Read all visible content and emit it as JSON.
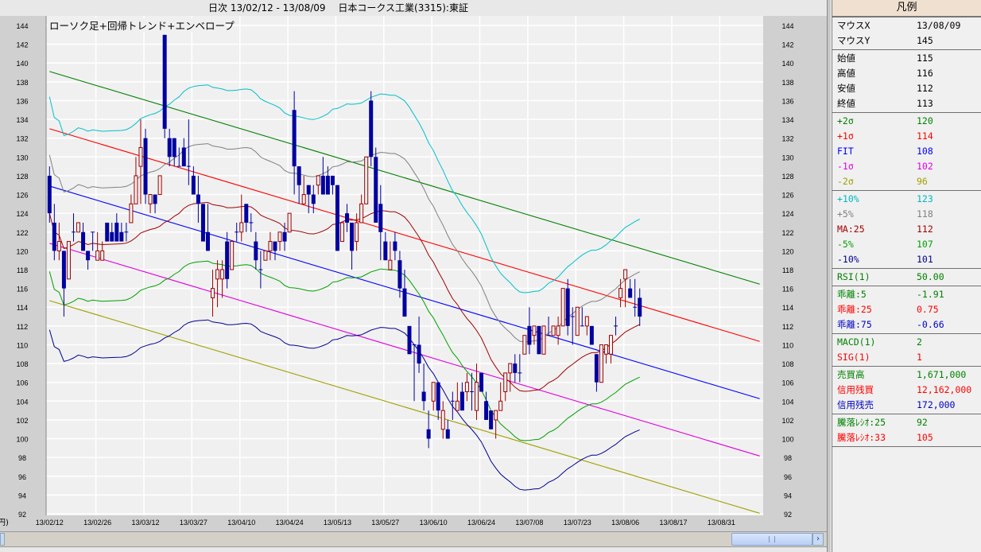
{
  "header": {
    "title": "日次 13/02/12 - 13/08/09　 日本コークス工業(3315):東証"
  },
  "chart_label": "ローソク足+回帰トレンド+エンベロープ",
  "unit_label": "円)",
  "legend": {
    "title": "凡例",
    "groups": [
      [
        {
          "label": "マウスX",
          "value": "13/08/09",
          "color": "#000000"
        },
        {
          "label": "マウスY",
          "value": "145",
          "color": "#000000"
        }
      ],
      [
        {
          "label": "始値",
          "value": "115",
          "color": "#000000"
        },
        {
          "label": "高値",
          "value": "116",
          "color": "#000000"
        },
        {
          "label": "安値",
          "value": "112",
          "color": "#000000"
        },
        {
          "label": "終値",
          "value": "113",
          "color": "#000000"
        }
      ],
      [
        {
          "label": "+2σ",
          "value": "120",
          "color": "#008000"
        },
        {
          "label": "+1σ",
          "value": "114",
          "color": "#ff0000"
        },
        {
          "label": "FIT",
          "value": "108",
          "color": "#0000ff"
        },
        {
          "label": "-1σ",
          "value": "102",
          "color": "#e000e0"
        },
        {
          "label": "-2σ",
          "value": "96",
          "color": "#a0a000"
        }
      ],
      [
        {
          "label": "+10%",
          "value": "123",
          "color": "#00b8c0"
        },
        {
          "label": "+5%",
          "value": "118",
          "color": "#808080"
        },
        {
          "label": "MA:25",
          "value": "112",
          "color": "#a00000"
        },
        {
          "label": "-5%",
          "value": "107",
          "color": "#00a000"
        },
        {
          "label": "-10%",
          "value": "101",
          "color": "#000090"
        }
      ],
      [
        {
          "label": "RSI(1)",
          "value": "50.00",
          "color": "#008000"
        }
      ],
      [
        {
          "label": "乖離:5",
          "value": "-1.91",
          "color": "#008000"
        },
        {
          "label": "乖離:25",
          "value": "0.75",
          "color": "#ff0000"
        },
        {
          "label": "乖離:75",
          "value": "-0.66",
          "color": "#0000c0"
        }
      ],
      [
        {
          "label": "MACD(1)",
          "value": "2",
          "color": "#008000"
        },
        {
          "label": "SIG(1)",
          "value": "1",
          "color": "#ff0000"
        }
      ],
      [
        {
          "label": "売買高",
          "value": "1,671,000",
          "color": "#008000"
        },
        {
          "label": "信用残買",
          "value": "12,162,000",
          "color": "#ff0000"
        },
        {
          "label": "信用残売",
          "value": "172,000",
          "color": "#0000c0"
        }
      ],
      [
        {
          "label": "騰落ﾚｼｵ:25",
          "value": "92",
          "color": "#008000"
        },
        {
          "label": "騰落ﾚｼｵ:33",
          "value": "105",
          "color": "#ff0000"
        }
      ]
    ]
  },
  "chart_data": {
    "type": "candlestick",
    "title": "ローソク足+回帰トレンド+エンベロープ",
    "ylim": [
      92,
      144
    ],
    "yticks": [
      144,
      142,
      140,
      138,
      136,
      134,
      132,
      130,
      128,
      126,
      124,
      122,
      120,
      118,
      116,
      114,
      112,
      110,
      108,
      106,
      104,
      102,
      100,
      98,
      96,
      94,
      92
    ],
    "xtick_labels": [
      "13/02/12",
      "13/02/26",
      "13/03/12",
      "13/03/27",
      "13/04/10",
      "13/04/24",
      "13/05/13",
      "13/05/27",
      "13/06/10",
      "13/06/24",
      "13/07/08",
      "13/07/23",
      "13/08/06",
      "13/08/17",
      "13/08/31"
    ],
    "xtick_every_bars": 10,
    "total_slots": 148,
    "candles_ohlc": [
      [
        128,
        129,
        123,
        124
      ],
      [
        123,
        125,
        119,
        120
      ],
      [
        120,
        123,
        119,
        121
      ],
      [
        120,
        120,
        113,
        116
      ],
      [
        117,
        121,
        117,
        121
      ],
      [
        122,
        124,
        121,
        122
      ],
      [
        122,
        123,
        122,
        123
      ],
      [
        122,
        123,
        120,
        120
      ],
      [
        120,
        120,
        118,
        119
      ],
      [
        122,
        122,
        120,
        122
      ],
      [
        119,
        122,
        119,
        120
      ],
      [
        119,
        121,
        119,
        120
      ],
      [
        123,
        123,
        121,
        121
      ],
      [
        122,
        123,
        121,
        121
      ],
      [
        123,
        124,
        121,
        121
      ],
      [
        122,
        123,
        121,
        121
      ],
      [
        122,
        123,
        121,
        122
      ],
      [
        123,
        126,
        123,
        125
      ],
      [
        125,
        130,
        125,
        128
      ],
      [
        129,
        134,
        125,
        131
      ],
      [
        132,
        133,
        125,
        126
      ],
      [
        125,
        126,
        124,
        126
      ],
      [
        126,
        126,
        124,
        125
      ],
      [
        126,
        128,
        126,
        128
      ],
      [
        143,
        143,
        132,
        133
      ],
      [
        132,
        133,
        129,
        130
      ],
      [
        132,
        132,
        129,
        130
      ],
      [
        129,
        131,
        129,
        129
      ],
      [
        131,
        132,
        129,
        129
      ],
      [
        129,
        134,
        127,
        129
      ],
      [
        128,
        129,
        126,
        126
      ],
      [
        126,
        128,
        123,
        125
      ],
      [
        125,
        125,
        121,
        121
      ],
      [
        122,
        125,
        120,
        120
      ],
      [
        115,
        118,
        113,
        116
      ],
      [
        117,
        119,
        114,
        118
      ],
      [
        117,
        119,
        115,
        118
      ],
      [
        121,
        122,
        116,
        117
      ],
      [
        118,
        121,
        118,
        121
      ],
      [
        122,
        123,
        121,
        122
      ],
      [
        122,
        126,
        121,
        123
      ],
      [
        125,
        125,
        122,
        123
      ],
      [
        123,
        124,
        122,
        123
      ],
      [
        121,
        122,
        118,
        119
      ],
      [
        118,
        120,
        116,
        118
      ],
      [
        119,
        120,
        119,
        120
      ],
      [
        120,
        122,
        119,
        121
      ],
      [
        121,
        121,
        119,
        120
      ],
      [
        121,
        122,
        120,
        122
      ],
      [
        122,
        123,
        120,
        121
      ],
      [
        122,
        124,
        122,
        124
      ],
      [
        135,
        137,
        126,
        129
      ],
      [
        129,
        129,
        125,
        127
      ],
      [
        125,
        128,
        125,
        126
      ],
      [
        127,
        127,
        124,
        126
      ],
      [
        126,
        127,
        124,
        125
      ],
      [
        127,
        128,
        126,
        128
      ],
      [
        128,
        130,
        126,
        126
      ],
      [
        128,
        129,
        126,
        126
      ],
      [
        128,
        128,
        126,
        127
      ],
      [
        127,
        127,
        120,
        120
      ],
      [
        121,
        123,
        121,
        123
      ],
      [
        124,
        125,
        122,
        123
      ],
      [
        123,
        123,
        118,
        120
      ],
      [
        121,
        124,
        120,
        123
      ],
      [
        123,
        126,
        123,
        125
      ],
      [
        125,
        130,
        125,
        130
      ],
      [
        136,
        137,
        129,
        130
      ],
      [
        130,
        131,
        123,
        123
      ],
      [
        125,
        127,
        119,
        122
      ],
      [
        121,
        122,
        119,
        119
      ],
      [
        118,
        121,
        118,
        119
      ],
      [
        121,
        122,
        119,
        120
      ],
      [
        119,
        120,
        115,
        116
      ],
      [
        116,
        118,
        113,
        113
      ],
      [
        112,
        112,
        109,
        109
      ],
      [
        110,
        110,
        104,
        110
      ],
      [
        110,
        113,
        107,
        108
      ],
      [
        105,
        108,
        103,
        104
      ],
      [
        101,
        103,
        99,
        100
      ],
      [
        104,
        106,
        103,
        106
      ],
      [
        106,
        106,
        102,
        103
      ],
      [
        101,
        104,
        100,
        103
      ],
      [
        101,
        102,
        100,
        100
      ],
      [
        104,
        105,
        102,
        104
      ],
      [
        103,
        106,
        103,
        104
      ],
      [
        105,
        106,
        103,
        103
      ],
      [
        105,
        107,
        104,
        106
      ],
      [
        105,
        107,
        103,
        105
      ],
      [
        103,
        108,
        102,
        106
      ],
      [
        107,
        107,
        105,
        105
      ],
      [
        104,
        105,
        102,
        102
      ],
      [
        103,
        103,
        101,
        101
      ],
      [
        102,
        103,
        100,
        103
      ],
      [
        103,
        106,
        103,
        104
      ],
      [
        105,
        107,
        104,
        107
      ],
      [
        107,
        108,
        105,
        108
      ],
      [
        108,
        109,
        106,
        107
      ],
      [
        107,
        109,
        106,
        107
      ],
      [
        109,
        111,
        109,
        111
      ],
      [
        112,
        114,
        109,
        110
      ],
      [
        111,
        112,
        110,
        112
      ],
      [
        112,
        112,
        109,
        109
      ],
      [
        109,
        112,
        109,
        112
      ],
      [
        111,
        113,
        111,
        111
      ],
      [
        111,
        112,
        111,
        112
      ],
      [
        111,
        113,
        110,
        112
      ],
      [
        112,
        116,
        112,
        116
      ],
      [
        116,
        117,
        111,
        112
      ],
      [
        113,
        114,
        110,
        113
      ],
      [
        111,
        114,
        111,
        114
      ],
      [
        112,
        114,
        112,
        112
      ],
      [
        112,
        113,
        111,
        113
      ],
      [
        112,
        112,
        110,
        110
      ],
      [
        109,
        109,
        105,
        106
      ],
      [
        106,
        110,
        106,
        110
      ],
      [
        109,
        110,
        108,
        110
      ],
      [
        109,
        111,
        108,
        111
      ],
      [
        112,
        113,
        111,
        112
      ],
      [
        115,
        117,
        114,
        116
      ],
      [
        117,
        118,
        114,
        118
      ],
      [
        116,
        117,
        115,
        115
      ],
      [
        114,
        117,
        113,
        114
      ],
      [
        115,
        116,
        112,
        113
      ]
    ],
    "regression": {
      "fit_start": 126.9,
      "slope_per_bar": -0.153,
      "sigma": 6.1
    },
    "ma_period": 25,
    "envelopes_pct": [
      10,
      5,
      -5,
      -10
    ],
    "colors": {
      "up": "#a00000",
      "down": "#0000a0",
      "plus2sigma": "#008000",
      "plus1sigma": "#ff0000",
      "fit": "#0000ff",
      "minus1sigma": "#e000e0",
      "minus2sigma": "#a0a000",
      "env_plus10": "#00c0c8",
      "env_plus5": "#808080",
      "ma": "#a00000",
      "env_minus5": "#00a000",
      "env_minus10": "#000090"
    }
  }
}
